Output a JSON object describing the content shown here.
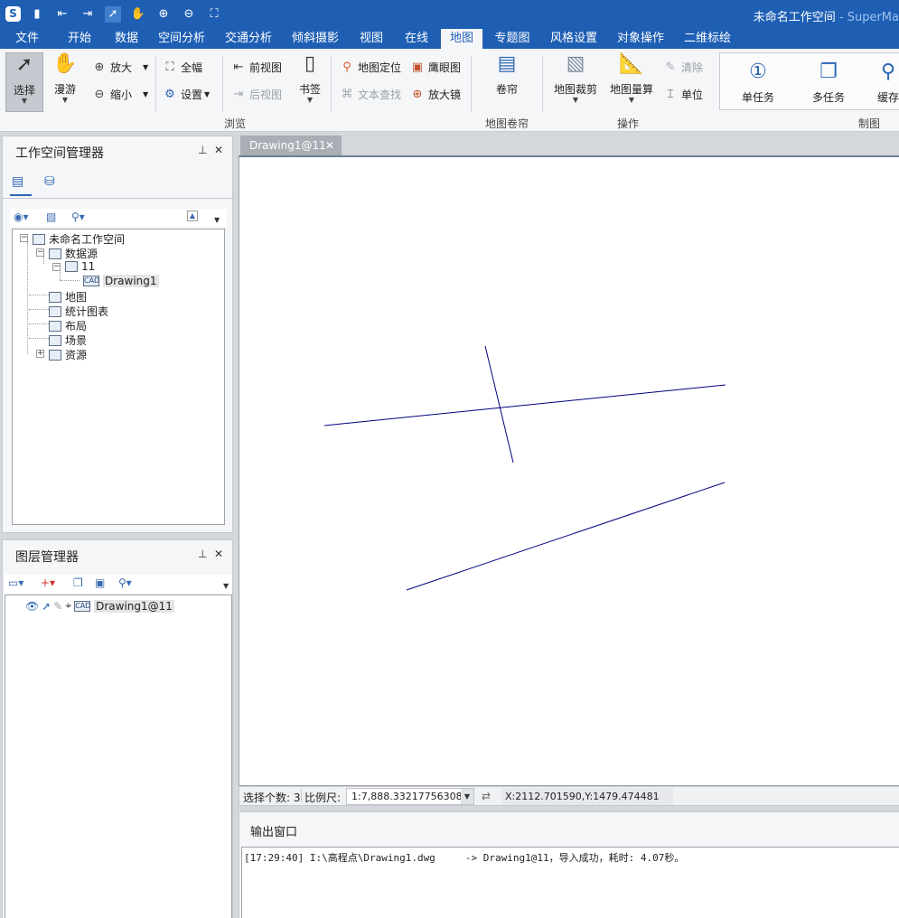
{
  "app": {
    "title": "未命名工作空间",
    "title_suffix": " - SuperMa"
  },
  "quick_access": [
    "logo",
    "save-icon",
    "import-icon",
    "export-icon",
    "select-icon",
    "pan-icon",
    "zoom-in-icon",
    "zoom-out-icon",
    "full-extent-icon"
  ],
  "menu_tabs": [
    "文件",
    "开始",
    "数据",
    "空间分析",
    "交通分析",
    "倾斜摄影",
    "视图",
    "在线",
    "地图",
    "专题图",
    "风格设置",
    "对象操作",
    "二维标绘"
  ],
  "active_tab": "地图",
  "ribbon": {
    "select": "选择",
    "pan": "漫游",
    "zoom_in": "放大",
    "zoom_out": "缩小",
    "full_extent": "全幅",
    "settings": "设置",
    "prev_view": "前视图",
    "next_view": "后视图",
    "bookmark": "书签",
    "map_locate": "地图定位",
    "text_search": "文本查找",
    "eagle_eye": "鹰眼图",
    "magnifier": "放大镜",
    "swipe": "卷帘",
    "map_clip": "地图裁剪",
    "map_measure": "地图量算",
    "clear": "清除",
    "unit": "单位",
    "single_task": "单任务",
    "multi_task": "多任务",
    "cache": "缓存",
    "groups": {
      "browse": "浏览",
      "swipe": "地图卷帘",
      "operation": "操作",
      "mapping": "制图"
    }
  },
  "workspace_panel": {
    "title": "工作空间管理器",
    "tree": {
      "workspace": "未命名工作空间",
      "datasources": "数据源",
      "datasource": "11",
      "dataset": "Drawing1",
      "maps": "地图",
      "charts": "统计图表",
      "layouts": "布局",
      "scenes": "场景",
      "resources": "资源"
    }
  },
  "layer_panel": {
    "title": "图层管理器",
    "layer": "Drawing1@11"
  },
  "document_tab": "Drawing1@11",
  "status_bar": {
    "selected": "选择个数: 3",
    "scale_label": "比例尺:",
    "scale_value": "1:7,888.33217756308",
    "coords": "X:2112.701590,Y:1479.474481"
  },
  "output": {
    "title": "输出窗口",
    "log": "[17:29:40] I:\\高程点\\Drawing1.dwg     -> Drawing1@11，导入成功，耗时: 4.07秒。"
  },
  "colors": {
    "accent": "#1e5fb4",
    "line": "#00007f"
  }
}
